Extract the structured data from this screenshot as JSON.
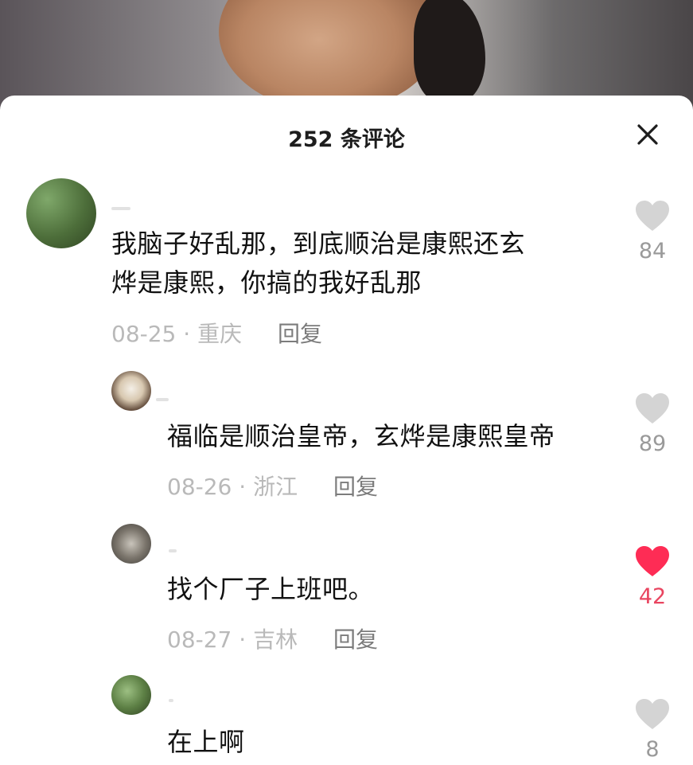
{
  "sheet": {
    "title": "252 条评论"
  },
  "colors": {
    "like_active": "#fe2c55",
    "like_inactive": "#d4d4d4",
    "meta_text": "#b9b9b9",
    "reply_text": "#7c7c7c"
  },
  "icons": {
    "close": "close-icon",
    "like": "heart-icon"
  },
  "comments": [
    {
      "text": "我脑子好乱那，到底顺治是康熙还玄烨是康熙，你搞的我好乱那",
      "line1": "我脑子好乱那，到底顺治是康熙还玄",
      "line2": "烨是康熙，你搞的我好乱那",
      "date": "08-25",
      "separator": "·",
      "location": "重庆",
      "reply_label": "回复",
      "likes": "84",
      "liked": false
    },
    {
      "text": "福临是顺治皇帝，玄烨是康熙皇帝",
      "date": "08-26",
      "separator": "·",
      "location": "浙江",
      "reply_label": "回复",
      "likes": "89",
      "liked": false
    },
    {
      "text": "找个厂子上班吧。",
      "date": "08-27",
      "separator": "·",
      "location": "吉林",
      "reply_label": "回复",
      "likes": "42",
      "liked": true
    },
    {
      "text": "在上啊",
      "likes": "8",
      "liked": false
    }
  ]
}
